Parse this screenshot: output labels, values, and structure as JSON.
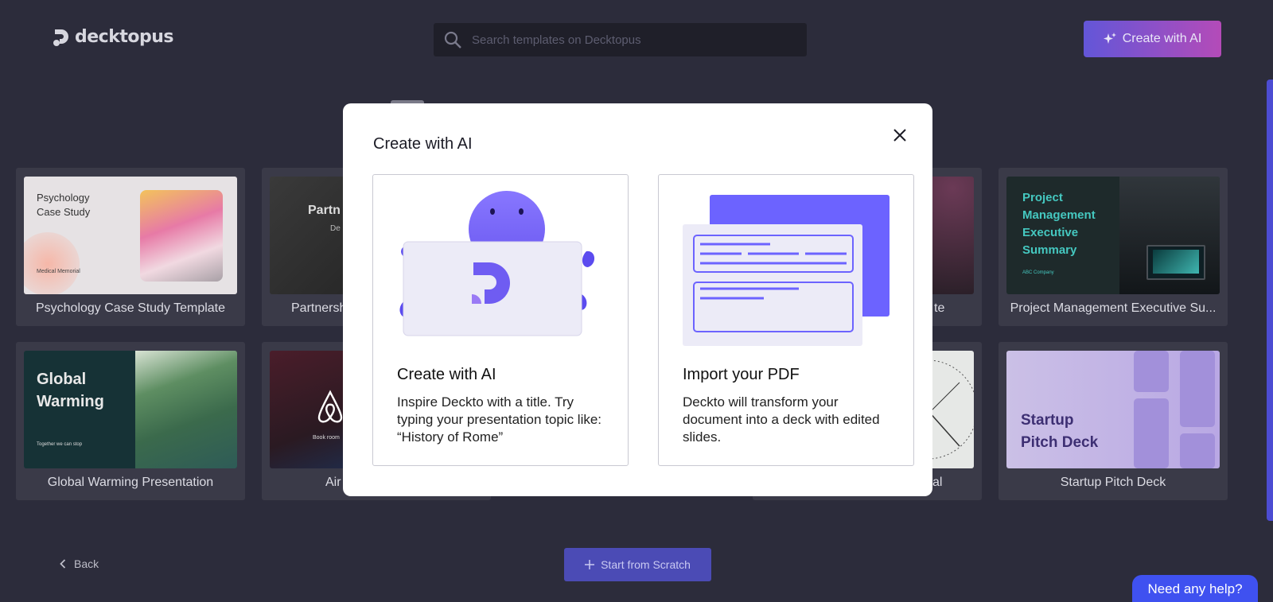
{
  "header": {
    "logo_text": "decktopus",
    "search_placeholder": "Search templates on Decktopus",
    "create_ai_label": "Create with AI"
  },
  "templates": [
    {
      "label": "Psychology Case Study Template",
      "thumb_title_1": "Psychology",
      "thumb_title_2": "Case Study",
      "thumb_sub": "Medical Memorial"
    },
    {
      "label": "Partnersh",
      "thumb_title": "Partn",
      "thumb_sub": "De"
    },
    {
      "label": "te"
    },
    {
      "label": "Project Management Executive Su...",
      "thumb_title_1": "Project",
      "thumb_title_2": "Management",
      "thumb_title_3": "Executive",
      "thumb_title_4": "Summary",
      "thumb_sub": "ABC Company"
    },
    {
      "label": "Global Warming Presentation",
      "thumb_title_1": "Global",
      "thumb_title_2": "Warming",
      "thumb_sub": "Together we can stop"
    },
    {
      "label": "Air",
      "thumb_sub": "Book room"
    },
    {
      "label": "al"
    },
    {
      "label": "Startup Pitch Deck",
      "thumb_title_1": "Startup",
      "thumb_title_2": "Pitch Deck"
    }
  ],
  "footer": {
    "back_label": "Back",
    "scratch_label": "Start from Scratch",
    "help_label": "Need any help?"
  },
  "modal": {
    "title": "Create with AI",
    "options": [
      {
        "title": "Create with AI",
        "description": "Inspire Deckto with a title. Try typing your presentation topic like: “History of Rome”"
      },
      {
        "title": "Import your PDF",
        "description": "Deckto will transform your document into a deck with edited slides."
      }
    ]
  },
  "colors": {
    "background": "#2c2c3b",
    "accent_purple": "#6c63ff",
    "help_blue": "#3f51f0"
  }
}
